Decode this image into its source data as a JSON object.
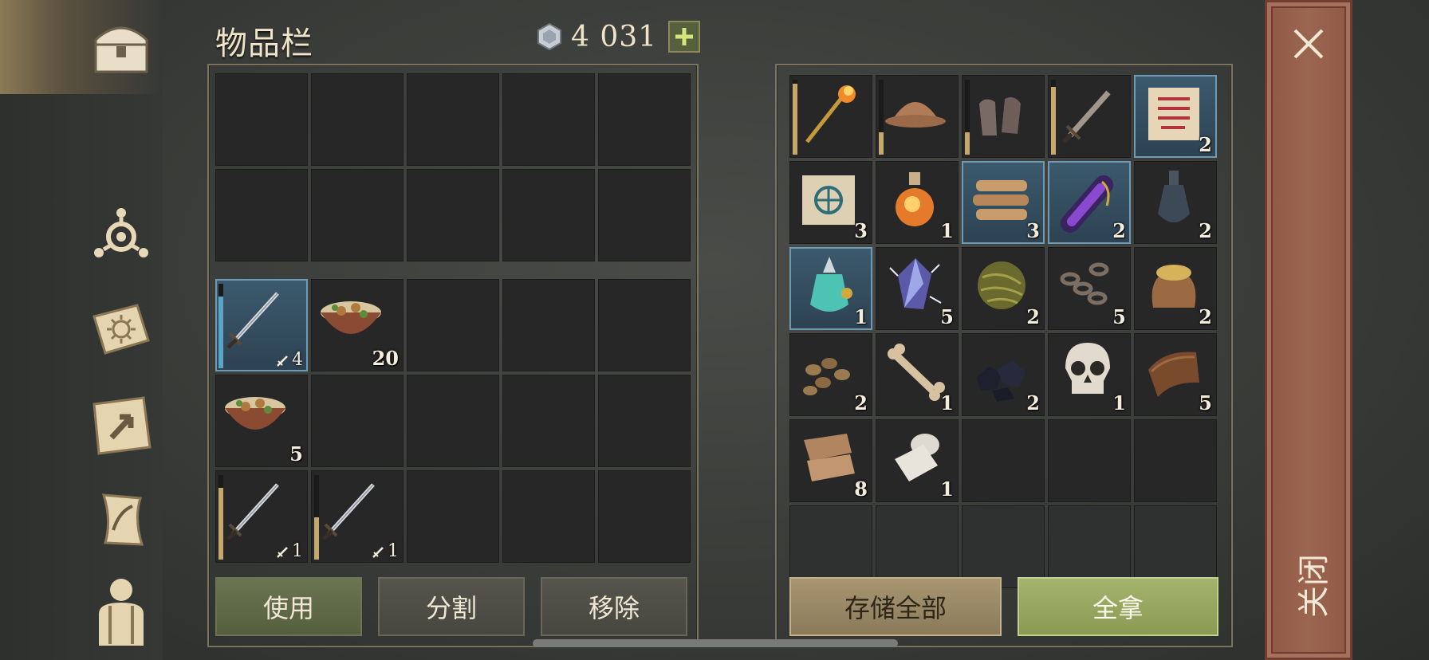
{
  "header": {
    "title": "物品栏",
    "currency_value": "4  031",
    "currency_icon": "silver-coin-icon",
    "plus_icon": "plus-icon"
  },
  "sidebar": {
    "items": [
      {
        "name": "chest-icon"
      },
      {
        "name": "crafting-icon"
      },
      {
        "name": "skills-book-icon"
      },
      {
        "name": "map-icon"
      },
      {
        "name": "journal-scroll-icon"
      },
      {
        "name": "character-icon"
      }
    ]
  },
  "inventory": {
    "hotbar_rows": 2,
    "slots": [
      {
        "item": "sword-icon",
        "dmg": "4",
        "highlight": true,
        "durability": 0.85,
        "dur_color": "blue"
      },
      {
        "item": "stew-bowl-icon",
        "qty": "20"
      },
      {},
      {},
      {},
      {
        "item": "stew-bowl-icon",
        "qty": "5"
      },
      {},
      {},
      {},
      {},
      {
        "item": "sword-icon",
        "dmg": "1",
        "durability": 0.85
      },
      {
        "item": "sword-icon",
        "dmg": "1",
        "durability": 0.5
      },
      {},
      {},
      {}
    ]
  },
  "buttons": {
    "use": "使用",
    "split": "分割",
    "remove": "移除",
    "store_all": "存储全部",
    "take_all": "全拿"
  },
  "storage": {
    "slots": [
      {
        "item": "fire-staff-icon",
        "durability": 0.95
      },
      {
        "item": "helmet-icon",
        "durability": 0.3
      },
      {
        "item": "gloves-icon",
        "durability": 0.3
      },
      {
        "item": "short-sword-icon",
        "durability": 0.9
      },
      {
        "item": "red-recipe-scroll-icon",
        "qty": "2",
        "highlight": true
      },
      {
        "item": "blue-recipe-scroll-icon",
        "qty": "3"
      },
      {
        "item": "fire-potion-icon",
        "qty": "1"
      },
      {
        "item": "firewood-icon",
        "qty": "3",
        "highlight": true
      },
      {
        "item": "purple-potion-icon",
        "qty": "2",
        "highlight": true
      },
      {
        "item": "empty-flask-icon",
        "qty": "2"
      },
      {
        "item": "teal-potion-icon",
        "qty": "1",
        "highlight": true
      },
      {
        "item": "crystal-icon",
        "qty": "5"
      },
      {
        "item": "grass-ball-icon",
        "qty": "2"
      },
      {
        "item": "chain-icon",
        "qty": "5"
      },
      {
        "item": "grain-sack-icon",
        "qty": "2"
      },
      {
        "item": "beans-icon",
        "qty": "2"
      },
      {
        "item": "bone-icon",
        "qty": "1"
      },
      {
        "item": "coal-icon",
        "qty": "2"
      },
      {
        "item": "skull-icon",
        "qty": "1"
      },
      {
        "item": "leather-icon",
        "qty": "5"
      },
      {
        "item": "cloth-icon",
        "qty": "8"
      },
      {
        "item": "paper-roll-icon",
        "qty": "1"
      },
      {},
      {},
      {},
      {
        "dim": true
      },
      {
        "dim": true
      },
      {
        "dim": true
      },
      {
        "dim": true
      },
      {
        "dim": true
      }
    ]
  },
  "close": {
    "icon": "close-icon",
    "label": "关闭"
  },
  "colors": {
    "accent_green": "#8a9a52",
    "close_panel": "#9b6650",
    "highlight": "#6f9ab4"
  }
}
